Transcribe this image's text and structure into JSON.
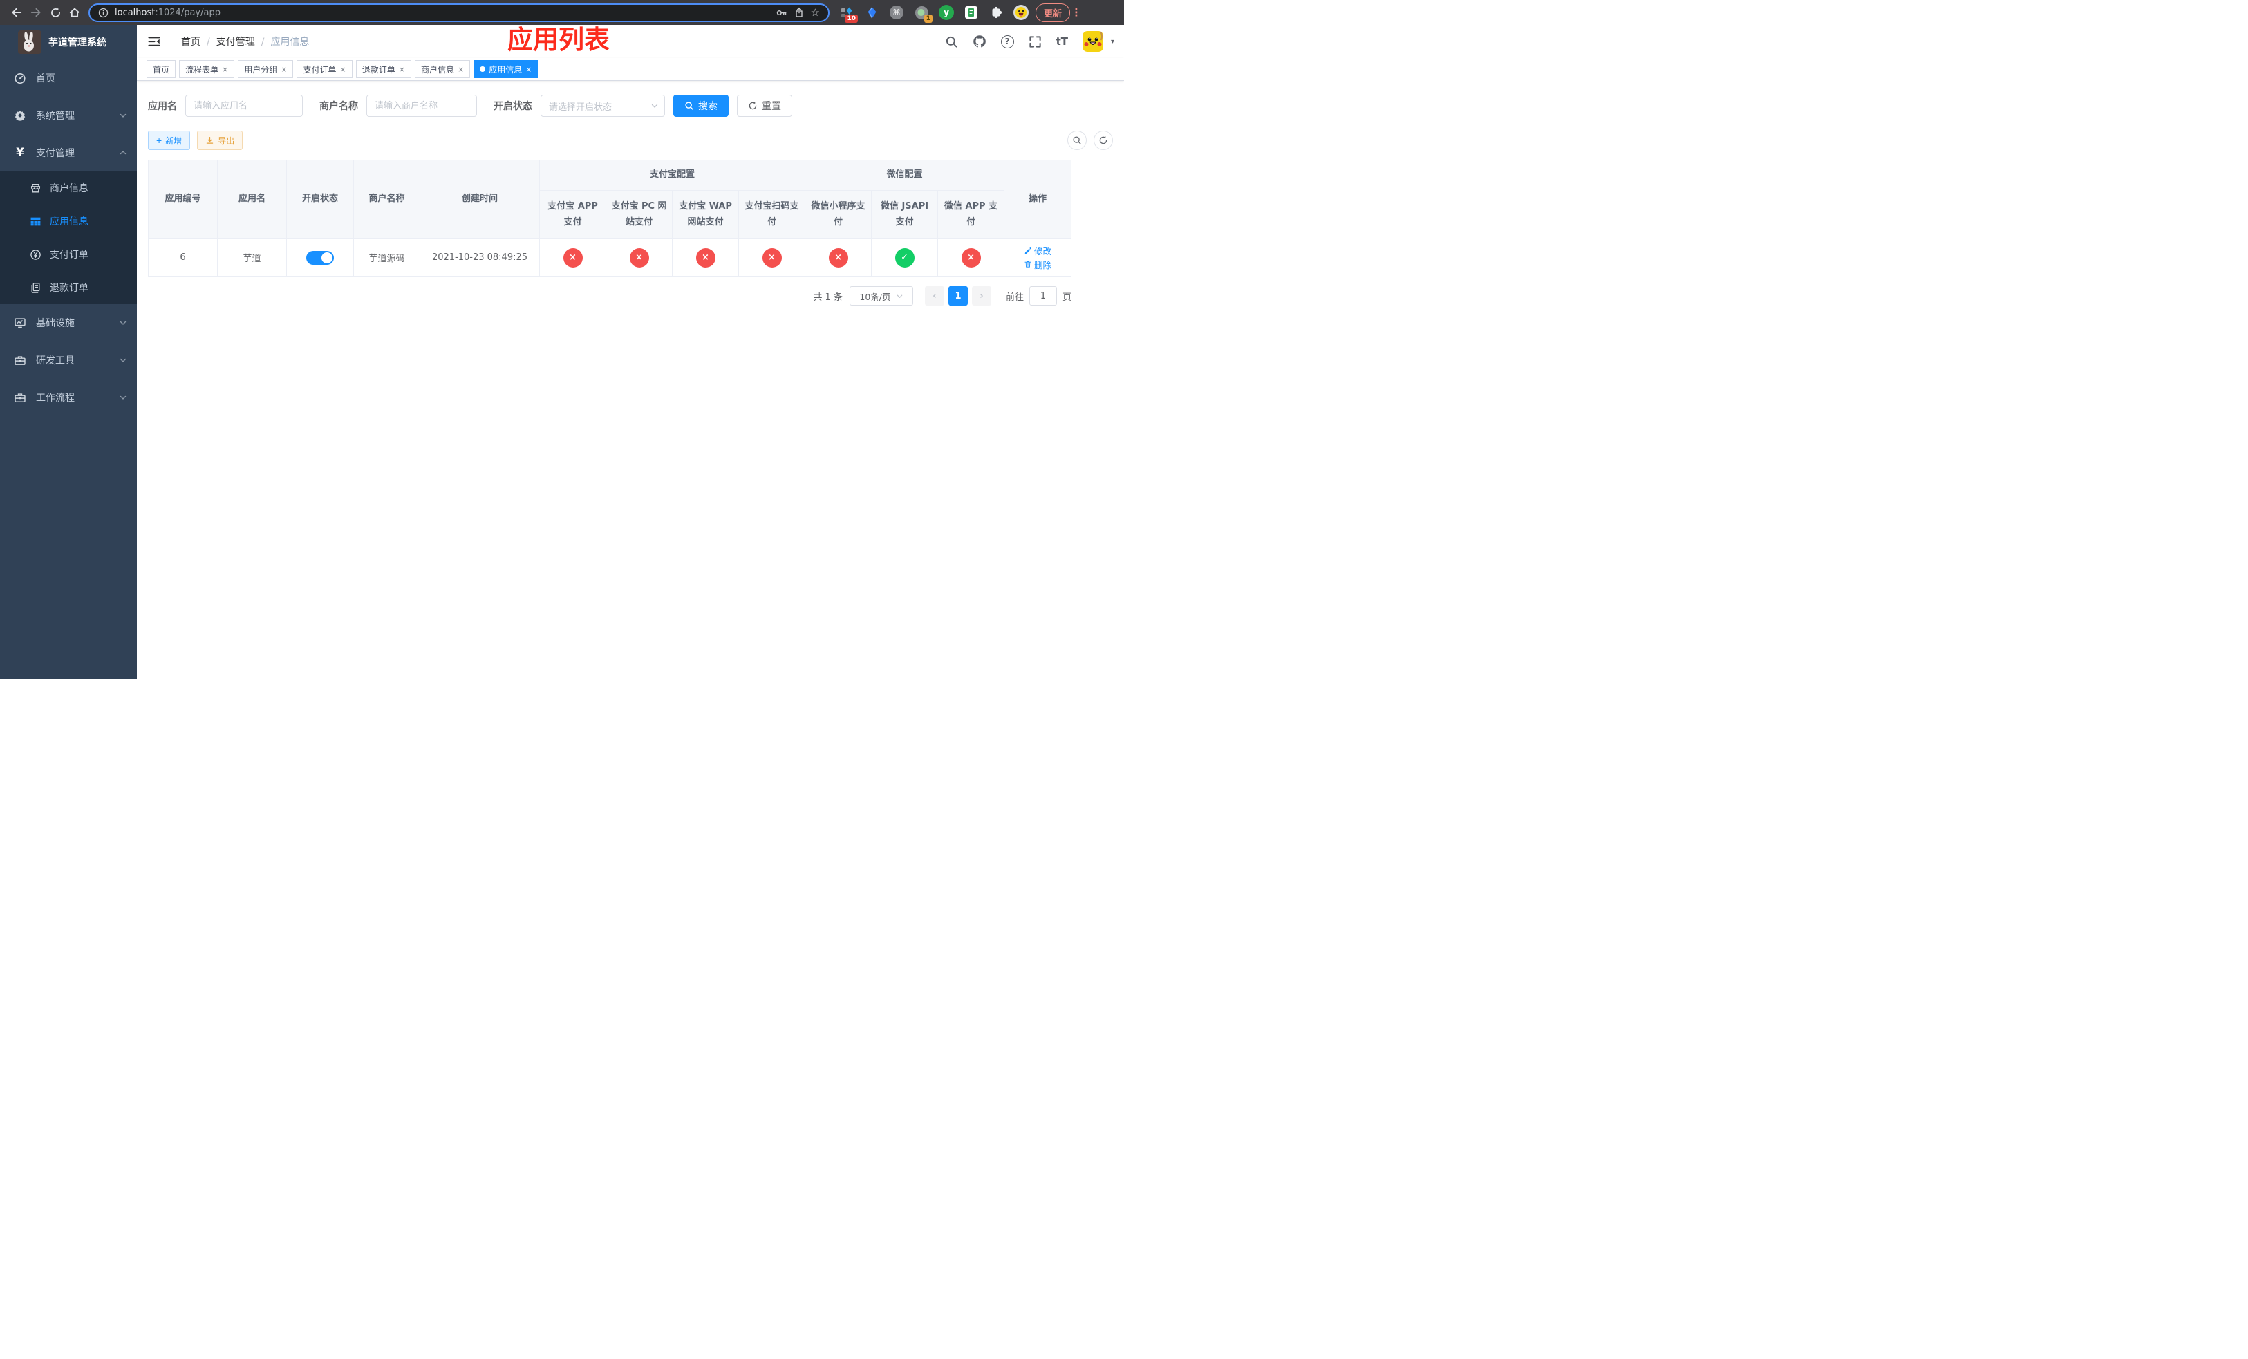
{
  "theme": {
    "primary": "#1890ff",
    "success": "#13ce66",
    "danger": "#f4504e",
    "warning": "#e6a23c",
    "sidebar_bg": "#304156",
    "submenu_bg": "#1f2d3d",
    "annotation_red": "#fc2b1c"
  },
  "browser": {
    "url_host": "localhost",
    "url_rest": ":1024/pay/app",
    "update_label": "更新",
    "ext_badge_grid": "10",
    "ext_badge_recorder": "1",
    "ext_y_label": "y"
  },
  "page": {
    "annotation": "应用列表"
  },
  "sidebar": {
    "title": "芋道管理系统",
    "items": [
      {
        "label": "首页",
        "icon": "dashboard-icon"
      },
      {
        "label": "系统管理",
        "icon": "gear-icon"
      },
      {
        "label": "支付管理",
        "icon": "yen-icon"
      },
      {
        "label": "基础设施",
        "icon": "monitor-icon"
      },
      {
        "label": "研发工具",
        "icon": "toolbox-icon"
      },
      {
        "label": "工作流程",
        "icon": "toolbox-icon"
      }
    ],
    "submenu": [
      {
        "label": "商户信息",
        "icon": "shop-icon"
      },
      {
        "label": "应用信息",
        "icon": "grid-icon",
        "active": true
      },
      {
        "label": "支付订单",
        "icon": "coin-icon"
      },
      {
        "label": "退款订单",
        "icon": "document-icon"
      }
    ]
  },
  "navbar": {
    "breadcrumb": [
      "首页",
      "支付管理",
      "应用信息"
    ]
  },
  "tabs": [
    {
      "label": "首页",
      "closable": false,
      "active": false
    },
    {
      "label": "流程表单",
      "closable": true,
      "active": false
    },
    {
      "label": "用户分组",
      "closable": true,
      "active": false
    },
    {
      "label": "支付订单",
      "closable": true,
      "active": false
    },
    {
      "label": "退款订单",
      "closable": true,
      "active": false
    },
    {
      "label": "商户信息",
      "closable": true,
      "active": false
    },
    {
      "label": "应用信息",
      "closable": true,
      "active": true
    }
  ],
  "filters": {
    "app_name_label": "应用名",
    "app_name_placeholder": "请输入应用名",
    "merchant_label": "商户名称",
    "merchant_placeholder": "请输入商户名称",
    "status_label": "开启状态",
    "status_placeholder": "请选择开启状态",
    "search_label": "搜索",
    "reset_label": "重置"
  },
  "toolbar": {
    "add_label": "新增",
    "export_label": "导出"
  },
  "table": {
    "columns": [
      "应用编号",
      "应用名",
      "开启状态",
      "商户名称",
      "创建时间"
    ],
    "groups": [
      {
        "label": "支付宝配置"
      },
      {
        "label": "微信配置"
      }
    ],
    "subcolumns": [
      "支付宝 APP 支付",
      "支付宝 PC 网站支付",
      "支付宝 WAP 网站支付",
      "支付宝扫码支付",
      "微信小程序支付",
      "微信 JSAPI 支付",
      "微信 APP 支付"
    ],
    "ops_label": "操作",
    "status_symbols": {
      "success": "✓",
      "error": "×"
    },
    "row": {
      "id": "6",
      "name": "芋道",
      "enabled": true,
      "merchant": "芋道源码",
      "created": "2021-10-23 08:49:25",
      "statuses": [
        "error",
        "error",
        "error",
        "error",
        "error",
        "success",
        "error"
      ],
      "edit_label": "修改",
      "delete_label": "删除"
    }
  },
  "pagination": {
    "total": "共 1 条",
    "page_size": "10条/页",
    "prev": "‹",
    "current": "1",
    "next": "›",
    "goto_label": "前往",
    "goto_value": "1",
    "page_label": "页"
  }
}
